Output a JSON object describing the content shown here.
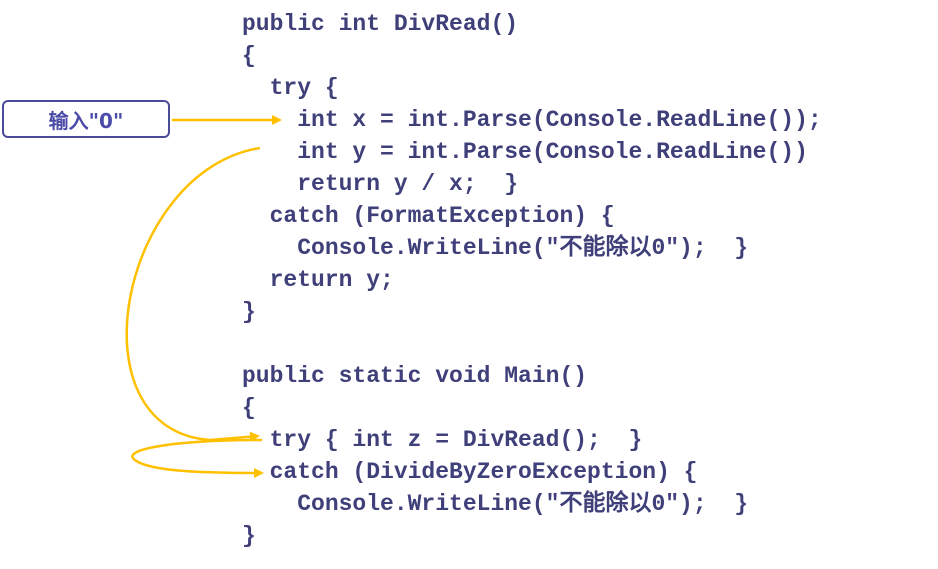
{
  "annotation": {
    "label": "输入\"0\""
  },
  "code": {
    "lines": [
      "public int DivRead()",
      "{",
      "  try {",
      "    int x = int.Parse(Console.ReadLine());",
      "    int y = int.Parse(Console.ReadLine())",
      "    return y / x;  }",
      "  catch (FormatException) {",
      "    Console.WriteLine(\"不能除以0\");  }",
      "  return y;",
      "}",
      "",
      "public static void Main()",
      "{",
      "  try { int z = DivRead();  }",
      "  catch (DivideByZeroException) {",
      "    Console.WriteLine(\"不能除以0\");  }",
      "}"
    ]
  },
  "colors": {
    "code_text": "#3f3f7a",
    "arrow": "#ffc000",
    "annotation_border": "#4b4b9a",
    "annotation_text": "#4b4ba8"
  }
}
